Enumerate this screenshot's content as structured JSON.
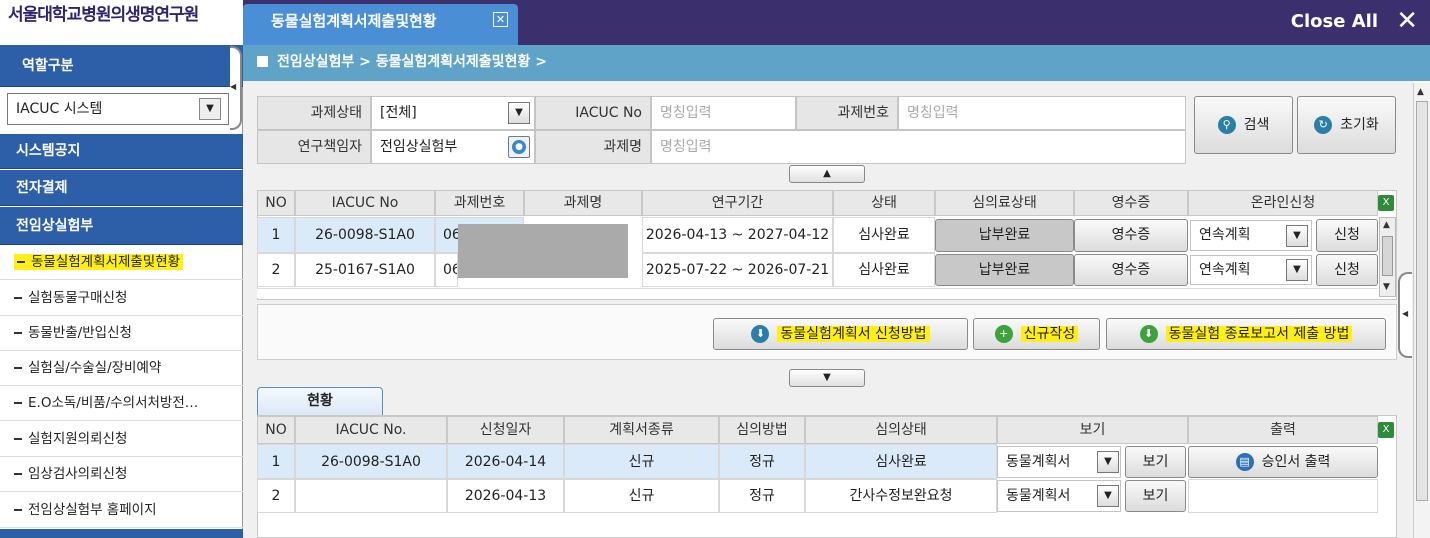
{
  "header": {
    "logo": "서울대학교병원의생명연구원",
    "tab_label": "동물실험계획서제출및현황",
    "tab_close": "✕",
    "close_all": "Close All",
    "close_all_x": "✕"
  },
  "sidebar": {
    "role_head": "역할구분",
    "role_value": "IACUC 시스템",
    "sections": [
      "시스템공지",
      "전자결제",
      "전임상실험부"
    ],
    "items": [
      "동물실험계획서제출및현황",
      "실험동물구매신청",
      "동물반출/반입신청",
      "실험실/수술실/장비예약",
      "E.O소독/비품/수의서처방전…",
      "실험지원의뢰신청",
      "임상검사의뢰신청",
      "전임상실험부 홈페이지"
    ]
  },
  "breadcrumb": "전임상실험부 > 동물실험계획서제출및현황 >",
  "search": {
    "status_label": "과제상태",
    "status_value": "[전체]",
    "iacuc_label": "IACUC No",
    "iacuc_ph": "명칭입력",
    "taskno_label": "과제번호",
    "taskno_ph": "명칭입력",
    "pi_label": "연구책임자",
    "pi_value": "전임상실험부",
    "title_label": "과제명",
    "title_ph": "명칭입력",
    "search_btn": "검색",
    "reset_btn": "초기화"
  },
  "table1": {
    "headers": [
      "NO",
      "IACUC No",
      "과제번호",
      "과제명",
      "연구기간",
      "상태",
      "심의료상태",
      "영수증",
      "온라인신청"
    ],
    "rows": [
      {
        "no": "1",
        "iacuc": "26-0098-S1A0",
        "taskno": "06",
        "period": "2026-04-13 ~ 2027-04-12",
        "status": "심사완료",
        "fee": "납부완료",
        "receipt": "영수증",
        "online": "연속계획",
        "apply": "신청"
      },
      {
        "no": "2",
        "iacuc": "25-0167-S1A0",
        "taskno": "06",
        "period": "2025-07-22 ~ 2026-07-21",
        "status": "심사완료",
        "fee": "납부완료",
        "receipt": "영수증",
        "online": "연속계획",
        "apply": "신청"
      }
    ]
  },
  "actions": {
    "method_btn": "동물실험계획서 신청방법",
    "new_btn": "신규작성",
    "final_btn": "동물실험 종료보고서 제출 방법"
  },
  "status": {
    "tab": "현황",
    "headers": [
      "NO",
      "IACUC No.",
      "신청일자",
      "계획서종류",
      "심의방법",
      "심의상태",
      "보기",
      "출력"
    ],
    "rows": [
      {
        "no": "1",
        "iacuc": "26-0098-S1A0",
        "date": "2026-04-14",
        "type": "신규",
        "method": "정규",
        "state": "심사완료",
        "view_sel": "동물계획서",
        "view_btn": "보기",
        "print_btn": "승인서 출력"
      },
      {
        "no": "2",
        "iacuc": "",
        "date": "2026-04-13",
        "type": "신규",
        "method": "정규",
        "state": "간사수정보완요청",
        "view_sel": "동물계획서",
        "view_btn": "보기",
        "print_btn": ""
      }
    ]
  },
  "colors": {
    "topbar": "#3b2f6e",
    "tab": "#4a8fd6",
    "sidebar_head": "#2d5ea8",
    "breadcrumb": "#5fa3c8",
    "highlight": "#ffef17"
  }
}
